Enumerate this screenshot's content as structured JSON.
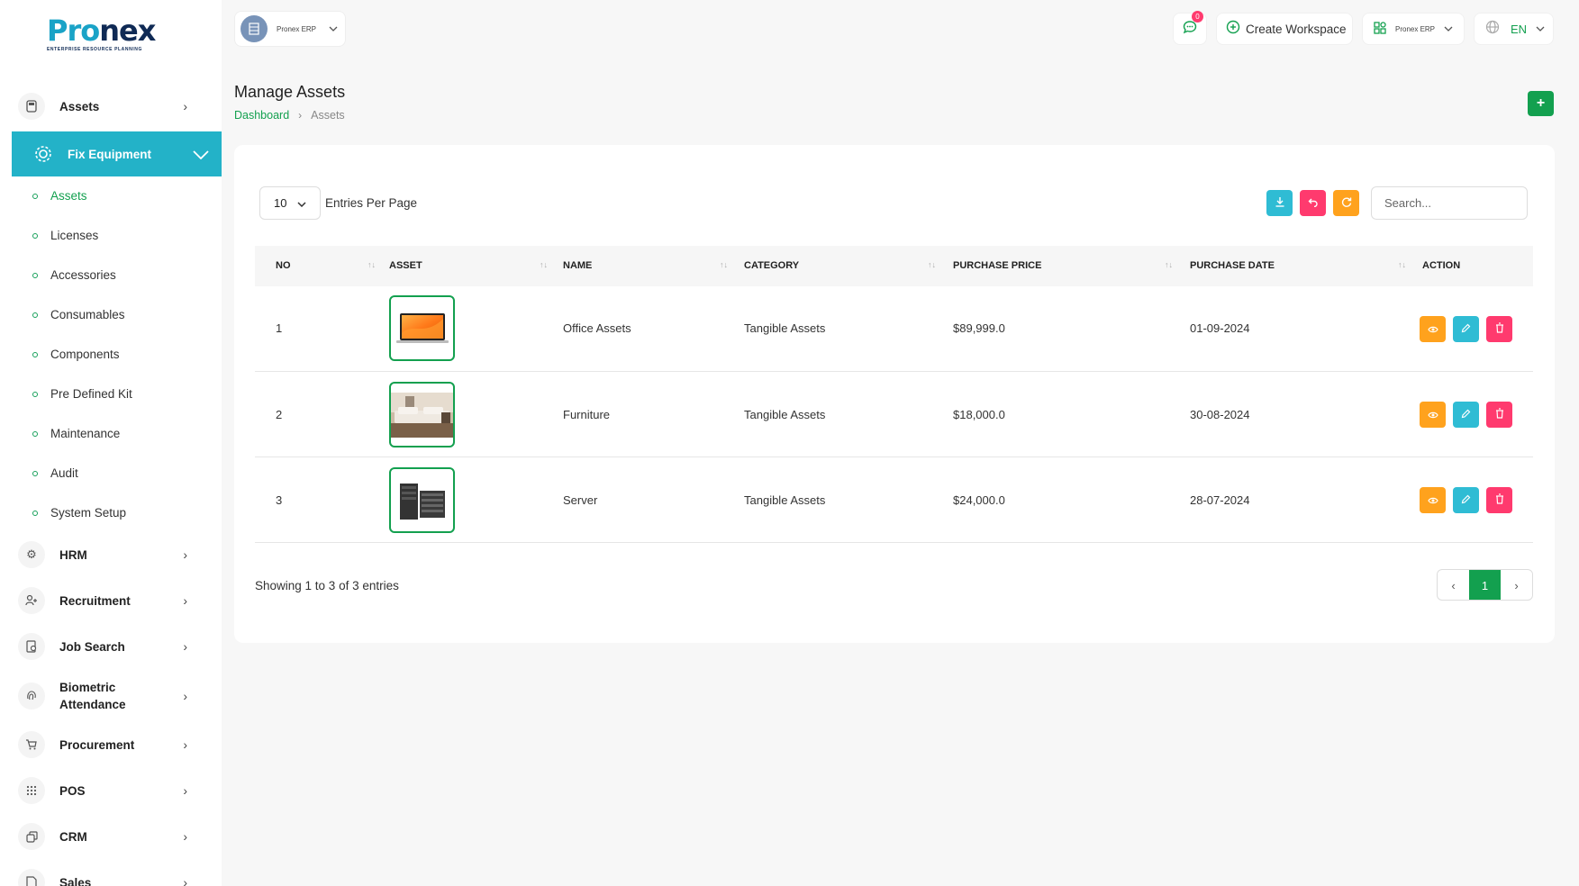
{
  "brand": {
    "logo_text_a": "P",
    "logo_text_b": "ro",
    "logo_text_c": "nex",
    "logo_tagline": "ENTERPRISE RESOURCE PLANNING",
    "accent": "#13a04f",
    "sidebar_active_bg": "#23b2c8"
  },
  "sidebar": {
    "top_items": [
      {
        "label": "Assets",
        "icon": "calculator-icon"
      }
    ],
    "active_item": {
      "label": "Fix Equipment",
      "icon": "gear-icon"
    },
    "sub_items": [
      {
        "label": "Assets",
        "active": true
      },
      {
        "label": "Licenses",
        "active": false
      },
      {
        "label": "Accessories",
        "active": false
      },
      {
        "label": "Consumables",
        "active": false
      },
      {
        "label": "Components",
        "active": false
      },
      {
        "label": "Pre Defined Kit",
        "active": false
      },
      {
        "label": "Maintenance",
        "active": false
      },
      {
        "label": "Audit",
        "active": false
      },
      {
        "label": "System Setup",
        "active": false
      }
    ],
    "bottom_items": [
      {
        "label": "HRM",
        "icon": "hrm-icon"
      },
      {
        "label": "Recruitment",
        "icon": "user-plus-icon"
      },
      {
        "label": "Job Search",
        "icon": "job-search-icon"
      },
      {
        "label": "Biometric",
        "label2": "Attendance",
        "icon": "fingerprint-icon"
      },
      {
        "label": "Procurement",
        "icon": "cart-icon"
      },
      {
        "label": "POS",
        "icon": "grid-icon"
      },
      {
        "label": "CRM",
        "icon": "crm-icon"
      },
      {
        "label": "Sales",
        "icon": "sales-icon"
      }
    ]
  },
  "header": {
    "workspace_name": "Pronex ERP",
    "notification_count": "0",
    "create_workspace_label": "Create Workspace",
    "erp_switch_label": "Pronex ERP",
    "language": "EN"
  },
  "page": {
    "title": "Manage Assets",
    "breadcrumb_home": "Dashboard",
    "breadcrumb_current": "Assets"
  },
  "table_controls": {
    "per_page_value": "10",
    "per_page_label": "Entries Per Page",
    "search_placeholder": "Search..."
  },
  "table": {
    "columns": [
      "NO",
      "ASSET",
      "NAME",
      "CATEGORY",
      "PURCHASE PRICE",
      "PURCHASE DATE",
      "ACTION"
    ],
    "rows": [
      {
        "no": "1",
        "image": "laptop",
        "name": "Office Assets",
        "category": "Tangible Assets",
        "price": "$89,999.0",
        "date": "01-09-2024"
      },
      {
        "no": "2",
        "image": "furniture",
        "name": "Furniture",
        "category": "Tangible Assets",
        "price": "$18,000.0",
        "date": "30-08-2024"
      },
      {
        "no": "3",
        "image": "server",
        "name": "Server",
        "category": "Tangible Assets",
        "price": "$24,000.0",
        "date": "28-07-2024"
      }
    ]
  },
  "footer": {
    "showing_text": "Showing 1 to 3 of 3 entries",
    "current_page": "1"
  }
}
